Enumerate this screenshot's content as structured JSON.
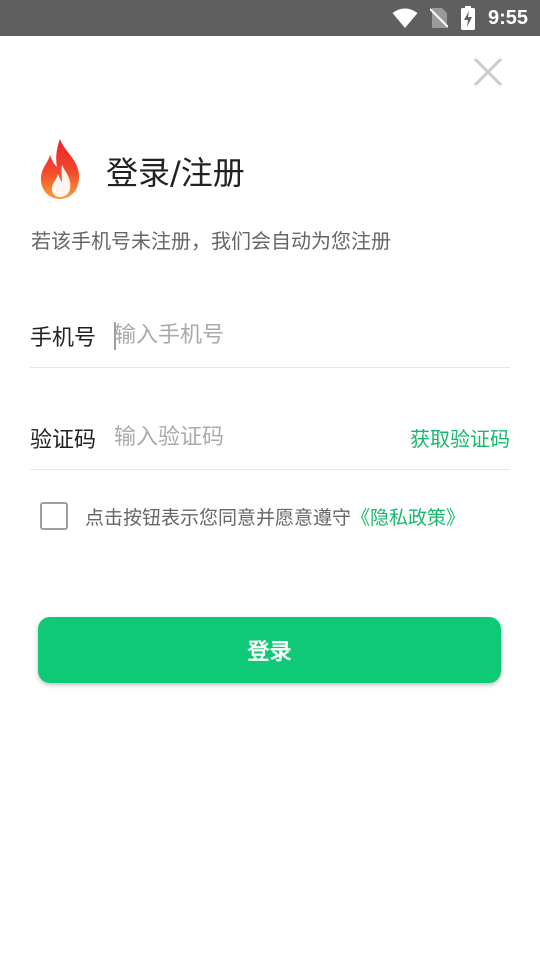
{
  "status_bar": {
    "time": "9:55",
    "icons": [
      "wifi-icon",
      "no-sim-icon",
      "battery-charging-icon"
    ]
  },
  "header": {
    "close_icon": "close-icon",
    "logo_icon": "flame-logo",
    "title": "登录/注册",
    "subtitle": "若该手机号未注册，我们会自动为您注册"
  },
  "form": {
    "phone": {
      "label": "手机号",
      "placeholder": "输入手机号",
      "value": ""
    },
    "code": {
      "label": "验证码",
      "placeholder": "输入验证码",
      "value": "",
      "get_code_label": "获取验证码"
    },
    "agreement": {
      "checked": false,
      "text": "点击按钮表示您同意并愿意遵守",
      "policy_link": "《隐私政策》"
    },
    "submit_label": "登录"
  },
  "colors": {
    "accent": "#0ec975",
    "link": "#17b86d",
    "status_bar": "#5f5f5f"
  }
}
